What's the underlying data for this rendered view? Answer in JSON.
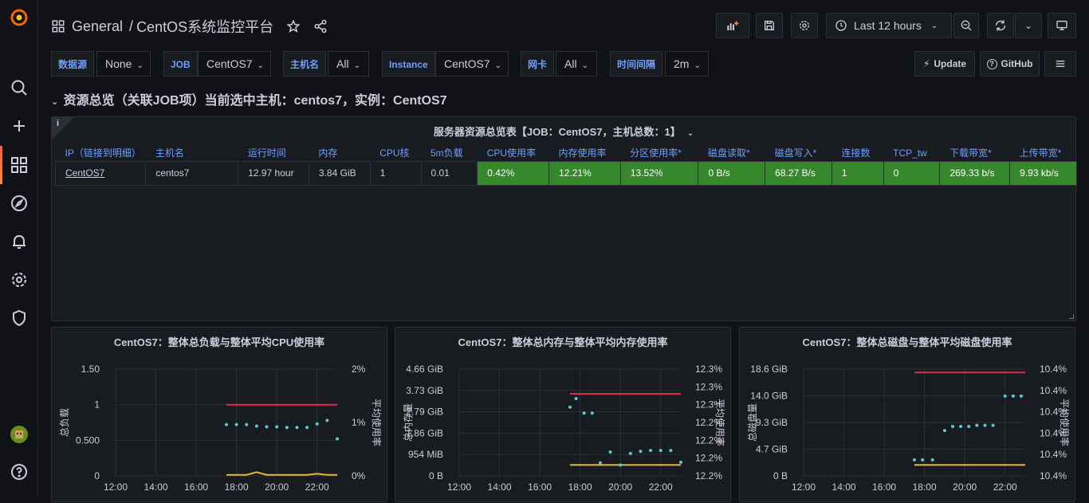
{
  "breadcrumb": {
    "folder": "General",
    "sep": "/",
    "title": "CentOS系统监控平台"
  },
  "time_picker": {
    "label": "Last 12 hours"
  },
  "variables": [
    {
      "label": "数据源",
      "value": "None"
    },
    {
      "label": "JOB",
      "value": "CentOS7"
    },
    {
      "label": "主机名",
      "value": "All"
    },
    {
      "label": "Instance",
      "value": "CentOS7"
    },
    {
      "label": "网卡",
      "value": "All"
    },
    {
      "label": "时间间隔",
      "value": "2m"
    }
  ],
  "links": {
    "update": "Update",
    "github": "GitHub"
  },
  "row_title": "资源总览（关联JOB项）当前选中主机：centos7，实例：CentOS7",
  "table_panel": {
    "title": "服务器资源总览表【JOB：CentOS7，主机总数：1】",
    "info": "i",
    "headers": [
      "IP（链接到明细）",
      "主机名",
      "运行时间",
      "内存",
      "CPU核",
      "5m负载",
      "CPU使用率",
      "内存使用率",
      "分区使用率*",
      "磁盘读取*",
      "磁盘写入*",
      "连接数",
      "TCP_tw",
      "下载带宽*",
      "上传带宽*"
    ],
    "row": [
      "CentOS7",
      "centos7",
      "12.97 hour",
      "3.84 GiB",
      "1",
      "0.01",
      "0.42%",
      "12.21%",
      "13.52%",
      "0 B/s",
      "68.27 B/s",
      "1",
      "0",
      "269.33 b/s",
      "9.93 kb/s"
    ]
  },
  "chart_data": [
    {
      "type": "line",
      "title": "CentOS7：整体总负载与整体平均CPU使用率",
      "ylabel": "总负载",
      "y2label": "平均使用率",
      "yticks": [
        "0",
        "0.500",
        "1",
        "1.50"
      ],
      "y2ticks": [
        "0%",
        "1%",
        "2%"
      ],
      "xticks": [
        "12:00",
        "14:00",
        "16:00",
        "18:00",
        "20:00",
        "22:00"
      ],
      "ylim": [
        0,
        1.5
      ],
      "y2lim": [
        0,
        2
      ],
      "x_hours": [
        12,
        23
      ],
      "series": [
        {
          "color": "#e02f44",
          "style": "line",
          "x": [
            17.5,
            23
          ],
          "values": [
            1,
            1
          ]
        },
        {
          "color": "#5ac7d6",
          "style": "points",
          "x": [
            17.5,
            18,
            18.5,
            19,
            19.5,
            20,
            20.5,
            21,
            21.5,
            22,
            22.5,
            23
          ],
          "values": [
            0.72,
            0.72,
            0.72,
            0.7,
            0.69,
            0.69,
            0.68,
            0.68,
            0.68,
            0.73,
            0.78,
            0.52
          ]
        },
        {
          "color": "#e5b736",
          "style": "line",
          "axis": "y2",
          "x": [
            17.5,
            18,
            18.5,
            19,
            19.5,
            20,
            20.5,
            21,
            21.5,
            22,
            22.5,
            23
          ],
          "values": [
            0.02,
            0.02,
            0.02,
            0.07,
            0.02,
            0.02,
            0.02,
            0.02,
            0.02,
            0.04,
            0.02,
            0.02
          ]
        }
      ]
    },
    {
      "type": "line",
      "title": "CentOS7：整体总内存与整体平均内存使用率",
      "ylabel": "总内存量",
      "y2label": "平均使用率",
      "yticks": [
        "0 B",
        "954 MiB",
        "1.86 GiB",
        "2.79 GiB",
        "3.73 GiB",
        "4.66 GiB"
      ],
      "y2ticks": [
        "12.2%",
        "12.2%",
        "12.2%",
        "12.2%",
        "12.3%",
        "12.3%",
        "12.3%"
      ],
      "xticks": [
        "12:00",
        "14:00",
        "16:00",
        "18:00",
        "20:00",
        "22:00"
      ],
      "ylim": [
        0,
        5
      ],
      "x_hours": [
        12,
        23
      ],
      "series": [
        {
          "color": "#e02f44",
          "style": "line",
          "x": [
            17.5,
            23
          ],
          "values": [
            3.84,
            3.84
          ]
        },
        {
          "color": "#e5b736",
          "style": "line",
          "x": [
            17.5,
            23
          ],
          "values": [
            0.51,
            0.51
          ]
        },
        {
          "color": "#5ac7d6",
          "style": "points",
          "x": [
            17.5,
            17.8,
            18.2,
            18.6,
            19,
            19.5,
            20,
            20.5,
            21,
            21.5,
            22,
            22.5,
            23
          ],
          "values": [
            3.22,
            3.62,
            2.94,
            2.94,
            0.61,
            1.12,
            0.51,
            1.05,
            1.15,
            1.19,
            1.19,
            1.19,
            0.64
          ]
        }
      ]
    },
    {
      "type": "line",
      "title": "CentOS7：整体总磁盘与整体平均磁盘使用率",
      "ylabel": "总磁盘量",
      "y2label": "平均使用率",
      "yticks": [
        "0 B",
        "4.7 GiB",
        "9.3 GiB",
        "14.0 GiB",
        "18.6 GiB"
      ],
      "y2ticks": [
        "10.4%",
        "10.4%",
        "10.4%",
        "10.4%",
        "10.4%",
        "10.4%"
      ],
      "xticks": [
        "12:00",
        "14:00",
        "16:00",
        "18:00",
        "20:00",
        "22:00"
      ],
      "ylim": [
        0,
        18.6
      ],
      "x_hours": [
        12,
        23
      ],
      "series": [
        {
          "color": "#e02f44",
          "style": "line",
          "x": [
            17.5,
            23
          ],
          "values": [
            18.0,
            18.0
          ]
        },
        {
          "color": "#e5b736",
          "style": "line",
          "x": [
            17.5,
            23
          ],
          "values": [
            1.9,
            1.9
          ]
        },
        {
          "color": "#5ac7d6",
          "style": "points",
          "x": [
            17.5,
            17.9,
            18.4,
            19,
            19.4,
            19.8,
            20.2,
            20.6,
            21,
            21.4,
            22,
            22.4,
            22.8
          ],
          "values": [
            2.8,
            2.8,
            2.8,
            7.9,
            8.6,
            8.6,
            8.6,
            8.8,
            8.8,
            8.8,
            13.9,
            13.9,
            13.9
          ]
        }
      ]
    }
  ]
}
